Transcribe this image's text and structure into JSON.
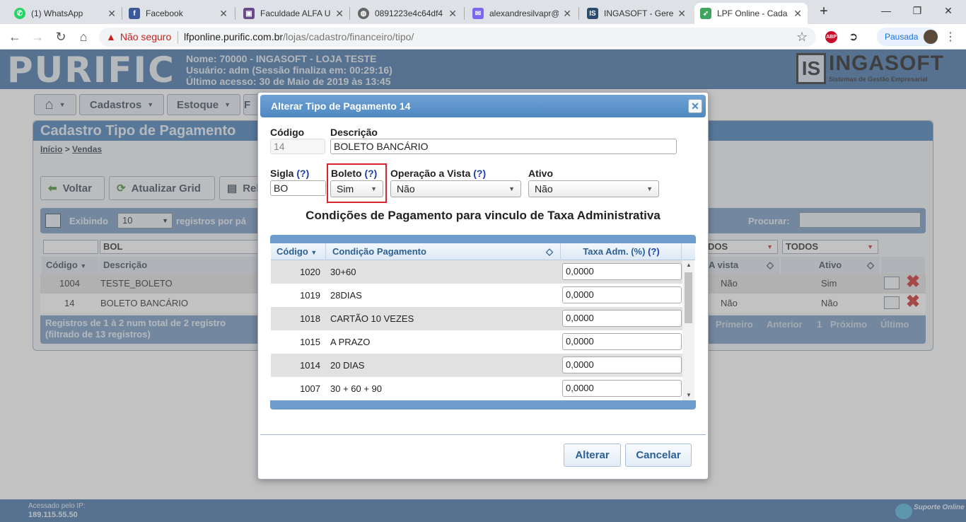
{
  "browser": {
    "tabs": [
      {
        "title": "(1) WhatsApp",
        "icon": "whatsapp-icon"
      },
      {
        "title": "Facebook",
        "icon": "facebook-icon"
      },
      {
        "title": "Faculdade ALFA Un",
        "icon": "faculdade-icon"
      },
      {
        "title": "0891223e4c64df4",
        "icon": "globe-icon"
      },
      {
        "title": "alexandresilvapr@",
        "icon": "mail-icon"
      },
      {
        "title": "INGASOFT - Geren",
        "icon": "ingasoft-icon"
      },
      {
        "title": "LPF Online - Cada",
        "icon": "lpf-icon"
      }
    ],
    "security_label": "Não seguro",
    "url_host": "lfponline.purific.com.br",
    "url_path": "/lojas/cadastro/financeiro/tipo/",
    "profile_label": "Pausada"
  },
  "header": {
    "logo": "PURIFIC",
    "line1": "Nome: 70000 - INGASOFT - LOJA TESTE",
    "line2": "Usuário: adm (Sessão finaliza em: 00:29:16)",
    "line3": "Último acesso: 30 de Maio de 2019 às 13:45",
    "brand_is": "IS",
    "brand_name": "INGASOFT",
    "brand_sub": "Sistemas de Gestão Empresarial"
  },
  "menu": {
    "cadastros": "Cadastros",
    "estoque": "Estoque",
    "partial": "F"
  },
  "panel": {
    "title": "Cadastro Tipo de Pagamento",
    "breadcrumb_home": "Início",
    "breadcrumb_sep": ">",
    "breadcrumb_current": "Vendas",
    "btn_voltar": "Voltar",
    "btn_atualizar": "Atualizar Grid",
    "btn_rel": "Rel",
    "showing": "Exibindo",
    "per_page": "10",
    "per_page_suffix": "registros por pá",
    "search_label": "Procurar:",
    "filter_desc": "BOL",
    "filter_avista": "DOS",
    "filter_ativo": "TODOS",
    "col_codigo": "Código",
    "col_descricao": "Descrição",
    "col_avista": "A vista",
    "col_ativo": "Ativo",
    "rows": [
      {
        "codigo": "1004",
        "descricao": "TESTE_BOLETO",
        "avista": "Não",
        "ativo": "Sim"
      },
      {
        "codigo": "14",
        "descricao": "BOLETO BANCÁRIO",
        "avista": "Não",
        "ativo": "Não"
      }
    ],
    "footer_line1": "Registros de 1 à 2 num total de 2 registro",
    "footer_line2": "(filtrado de 13 registros)",
    "pager": [
      "Primeiro",
      "Anterior",
      "1",
      "Próximo",
      "Último"
    ]
  },
  "footer": {
    "ip_label": "Acessado pelo IP:",
    "ip": "189.115.55.50",
    "support": "Suporte Online"
  },
  "dialog": {
    "title": "Alterar Tipo de Pagamento 14",
    "codigo_label": "Código",
    "codigo_value": "14",
    "descricao_label": "Descrição",
    "descricao_value": "BOLETO BANCÁRIO",
    "sigla_label": "Sigla",
    "help": "(?)",
    "sigla_value": "BO",
    "boleto_label": "Boleto",
    "boleto_value": "Sim",
    "operacao_label": "Operação a Vista",
    "operacao_value": "Não",
    "ativo_label": "Ativo",
    "ativo_value": "Não",
    "conditions_title": "Condições de Pagamento para vinculo de Taxa Administrativa",
    "col_codigo": "Código",
    "col_condicao": "Condição Pagamento",
    "col_taxa": "Taxa Adm. (%)",
    "rows": [
      {
        "codigo": "1020",
        "condicao": "30+60",
        "taxa": "0,0000"
      },
      {
        "codigo": "1019",
        "condicao": "28DIAS",
        "taxa": "0,0000"
      },
      {
        "codigo": "1018",
        "condicao": "CARTÃO 10 VEZES",
        "taxa": "0,0000"
      },
      {
        "codigo": "1015",
        "condicao": "A PRAZO",
        "taxa": "0,0000"
      },
      {
        "codigo": "1014",
        "condicao": "20 DIAS",
        "taxa": "0,0000"
      },
      {
        "codigo": "1007",
        "condicao": "30 + 60 + 90",
        "taxa": "0,0000"
      }
    ],
    "btn_alterar": "Alterar",
    "btn_cancelar": "Cancelar"
  },
  "colors": {
    "header_blue": "#3b6ea5",
    "dialog_title": "#5a91c8",
    "highlight_red": "#d9232e",
    "help_blue": "#1b3fa8"
  }
}
